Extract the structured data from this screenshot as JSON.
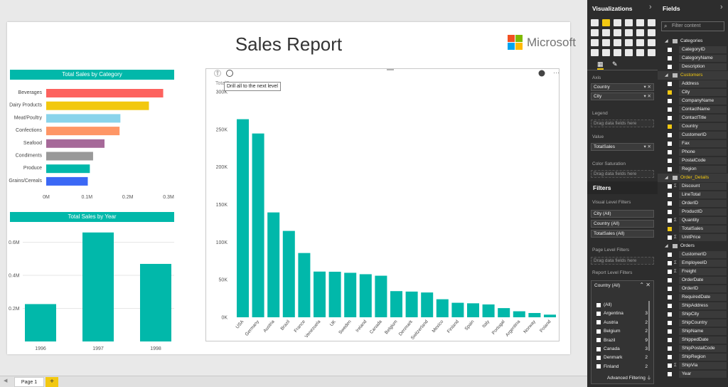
{
  "report": {
    "title": "Sales Report",
    "logo_text": "Microsoft",
    "logo_colors": [
      "#f25022",
      "#7fba00",
      "#00a4ef",
      "#ffb900"
    ]
  },
  "tooltip": "Drill all to the next level",
  "category_chart": {
    "title": "Total Sales by Category",
    "type": "bar",
    "categories": [
      "Beverages",
      "Dairy Products",
      "Meat/Poultry",
      "Confections",
      "Seafood",
      "Condiments",
      "Produce",
      "Grains/Cereals"
    ],
    "values": [
      0.287,
      0.252,
      0.182,
      0.18,
      0.143,
      0.115,
      0.107,
      0.102
    ],
    "colors": [
      "#fd625e",
      "#f2c80f",
      "#8ad4eb",
      "#fe9666",
      "#a66999",
      "#999999",
      "#01b8aa",
      "#3b68f5"
    ],
    "ticks": [
      "0M",
      "0.1M",
      "0.2M",
      "0.3M"
    ],
    "xlim": [
      0,
      0.3
    ]
  },
  "year_chart": {
    "title": "Total Sales by Year",
    "type": "bar",
    "categories": [
      "1996",
      "1997",
      "1998"
    ],
    "values": [
      0.226,
      0.659,
      0.469
    ],
    "ticks": [
      "0.2M",
      "0.4M",
      "0.6M"
    ],
    "ylim": [
      0,
      0.7
    ],
    "color": "#01b8aa"
  },
  "chart_data": [
    {
      "type": "bar",
      "title": "Total Sales by Category",
      "categories": [
        "Beverages",
        "Dairy Products",
        "Meat/Poultry",
        "Confections",
        "Seafood",
        "Condiments",
        "Produce",
        "Grains/Cereals"
      ],
      "values": [
        0.287,
        0.252,
        0.182,
        0.18,
        0.143,
        0.115,
        0.107,
        0.102
      ],
      "orientation": "horizontal",
      "xlim": [
        0,
        0.3
      ]
    },
    {
      "type": "bar",
      "title": "Total Sales by Year",
      "categories": [
        "1996",
        "1997",
        "1998"
      ],
      "values": [
        0.226,
        0.659,
        0.469
      ],
      "ylim": [
        0,
        0.7
      ]
    },
    {
      "type": "bar",
      "title": "TotalS",
      "categories": [
        "USA",
        "Germany",
        "Austria",
        "Brazil",
        "France",
        "Venezuela",
        "UK",
        "Sweden",
        "Ireland",
        "Canada",
        "Belgium",
        "Denmark",
        "Switzerland",
        "Mexico",
        "Finland",
        "Spain",
        "Italy",
        "Portugal",
        "Argentina",
        "Norway",
        "Poland"
      ],
      "values": [
        263500,
        244500,
        139500,
        114900,
        85500,
        60800,
        60600,
        59200,
        57300,
        55300,
        34800,
        34200,
        33000,
        24000,
        19300,
        18600,
        17100,
        12200,
        8000,
        5700,
        3500
      ],
      "ylim": [
        0,
        300000
      ],
      "ticks": [
        "0K",
        "50K",
        "100K",
        "150K",
        "200K",
        "250K",
        "300K"
      ]
    }
  ],
  "country_chart": {
    "title": "TotalS",
    "categories": [
      "USA",
      "Germany",
      "Austria",
      "Brazil",
      "France",
      "Venezuela",
      "UK",
      "Sweden",
      "Ireland",
      "Canada",
      "Belgium",
      "Denmark",
      "Switzerland",
      "Mexico",
      "Finland",
      "Spain",
      "Italy",
      "Portugal",
      "Argentina",
      "Norway",
      "Poland"
    ],
    "values": [
      263500,
      244500,
      139500,
      114900,
      85500,
      60800,
      60600,
      59200,
      57300,
      55300,
      34800,
      34200,
      33000,
      24000,
      19300,
      18600,
      17100,
      12200,
      8000,
      5700,
      3500
    ],
    "ticks": [
      "0K",
      "50K",
      "100K",
      "150K",
      "200K",
      "250K",
      "300K"
    ],
    "ylim": [
      0,
      300000
    ],
    "color": "#01b8aa"
  },
  "bottom_bar": {
    "page_tab": "Page 1",
    "add_label": "+"
  },
  "viz_pane": {
    "title": "Visualizations",
    "chevron": "›",
    "axis_label": "Axis",
    "axis_fields": [
      "Country",
      "City"
    ],
    "legend_label": "Legend",
    "legend_drop": "Drag data fields here",
    "value_label": "Value",
    "value_field": "TotalSales",
    "saturation_label": "Color Saturation",
    "saturation_drop": "Drag data fields here",
    "filters_title": "Filters",
    "visual_filters_label": "Visual Level Filters",
    "visual_filters": [
      "City (All)",
      "Country (All)",
      "TotalSales (All)"
    ],
    "page_filters_label": "Page Level Filters",
    "page_filters_drop": "Drag data fields here",
    "report_filters_label": "Report Level Filters",
    "filter_card": {
      "title": "Country (All)",
      "items": [
        {
          "label": "(All)",
          "count": ""
        },
        {
          "label": "Argentina",
          "count": "3"
        },
        {
          "label": "Austria",
          "count": "2"
        },
        {
          "label": "Belgium",
          "count": "2"
        },
        {
          "label": "Brazil",
          "count": "9"
        },
        {
          "label": "Canada",
          "count": "3"
        },
        {
          "label": "Denmark",
          "count": "2"
        },
        {
          "label": "Finland",
          "count": "2"
        }
      ],
      "advanced": "Advanced Filtering"
    }
  },
  "fields_pane": {
    "title": "Fields",
    "chevron": "›",
    "search_placeholder": "Filter content",
    "tables": [
      {
        "name": "Categories",
        "highlight": false,
        "fields": [
          {
            "name": "CategoryID",
            "checked": false,
            "sigma": false
          },
          {
            "name": "CategoryName",
            "checked": false,
            "sigma": false
          },
          {
            "name": "Description",
            "checked": false,
            "sigma": false
          }
        ]
      },
      {
        "name": "Customers",
        "highlight": true,
        "fields": [
          {
            "name": "Address",
            "checked": false,
            "sigma": false
          },
          {
            "name": "City",
            "checked": true,
            "sigma": false
          },
          {
            "name": "CompanyName",
            "checked": false,
            "sigma": false
          },
          {
            "name": "ContactName",
            "checked": false,
            "sigma": false
          },
          {
            "name": "ContactTitle",
            "checked": false,
            "sigma": false
          },
          {
            "name": "Country",
            "checked": true,
            "sigma": false
          },
          {
            "name": "CustomerID",
            "checked": false,
            "sigma": false
          },
          {
            "name": "Fax",
            "checked": false,
            "sigma": false
          },
          {
            "name": "Phone",
            "checked": false,
            "sigma": false
          },
          {
            "name": "PostalCode",
            "checked": false,
            "sigma": false
          },
          {
            "name": "Region",
            "checked": false,
            "sigma": false
          }
        ]
      },
      {
        "name": "Order_Details",
        "highlight": true,
        "fields": [
          {
            "name": "Discount",
            "checked": false,
            "sigma": true
          },
          {
            "name": "LineTotal",
            "checked": false,
            "sigma": false
          },
          {
            "name": "OrderID",
            "checked": false,
            "sigma": false
          },
          {
            "name": "ProductID",
            "checked": false,
            "sigma": false
          },
          {
            "name": "Quantity",
            "checked": false,
            "sigma": true
          },
          {
            "name": "TotalSales",
            "checked": true,
            "sigma": false
          },
          {
            "name": "UnitPrice",
            "checked": false,
            "sigma": true
          }
        ]
      },
      {
        "name": "Orders",
        "highlight": false,
        "fields": [
          {
            "name": "CustomerID",
            "checked": false,
            "sigma": false
          },
          {
            "name": "EmployeeID",
            "checked": false,
            "sigma": true
          },
          {
            "name": "Freight",
            "checked": false,
            "sigma": true
          },
          {
            "name": "OrderDate",
            "checked": false,
            "sigma": false
          },
          {
            "name": "OrderID",
            "checked": false,
            "sigma": false
          },
          {
            "name": "RequiredDate",
            "checked": false,
            "sigma": false
          },
          {
            "name": "ShipAddress",
            "checked": false,
            "sigma": false
          },
          {
            "name": "ShipCity",
            "checked": false,
            "sigma": false
          },
          {
            "name": "ShipCountry",
            "checked": false,
            "sigma": false
          },
          {
            "name": "ShipName",
            "checked": false,
            "sigma": false
          },
          {
            "name": "ShippedDate",
            "checked": false,
            "sigma": false
          },
          {
            "name": "ShipPostalCode",
            "checked": false,
            "sigma": false
          },
          {
            "name": "ShipRegion",
            "checked": false,
            "sigma": false
          },
          {
            "name": "ShipVia",
            "checked": false,
            "sigma": true
          },
          {
            "name": "Year",
            "checked": false,
            "sigma": false
          }
        ]
      }
    ]
  }
}
